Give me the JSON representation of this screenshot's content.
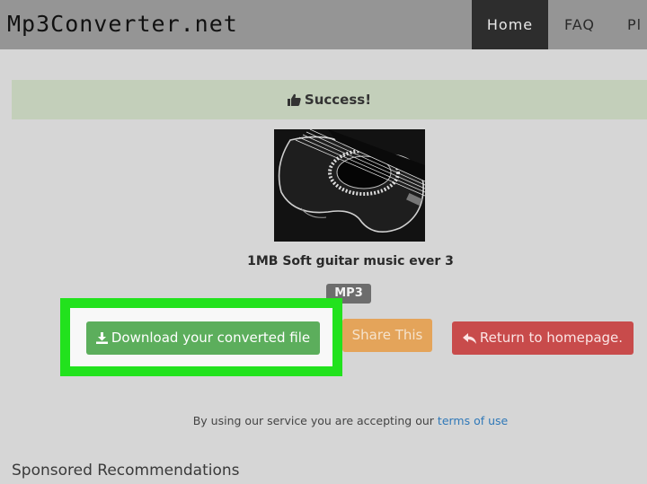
{
  "navbar": {
    "brand": "Mp3Converter.net",
    "items": [
      {
        "label": "Home",
        "active": true
      },
      {
        "label": "FAQ",
        "active": false
      },
      {
        "label": "Pl",
        "active": false
      }
    ]
  },
  "alert": {
    "icon": "thumbs-up-icon",
    "text": "Success!"
  },
  "result": {
    "cover_icon": "guitar-image",
    "title": "1MB Soft guitar music ever 3",
    "format": "MP3"
  },
  "buttons": {
    "download_icon": "download-icon",
    "download_label": "Download your converted file",
    "share_label": "Share This",
    "return_icon": "reply-icon",
    "return_label": "Return to homepage."
  },
  "footer": {
    "terms_prefix": "By using our service you are accepting our",
    "terms_link": "terms of use"
  },
  "sponsored_heading": "Sponsored Recommendations",
  "colors": {
    "success_bg": "#c3cfba",
    "download_btn": "#5cae5c",
    "share_btn": "#e4a45a",
    "return_btn": "#c84b4b",
    "highlight": "#22e21d",
    "link": "#2f78b8"
  }
}
